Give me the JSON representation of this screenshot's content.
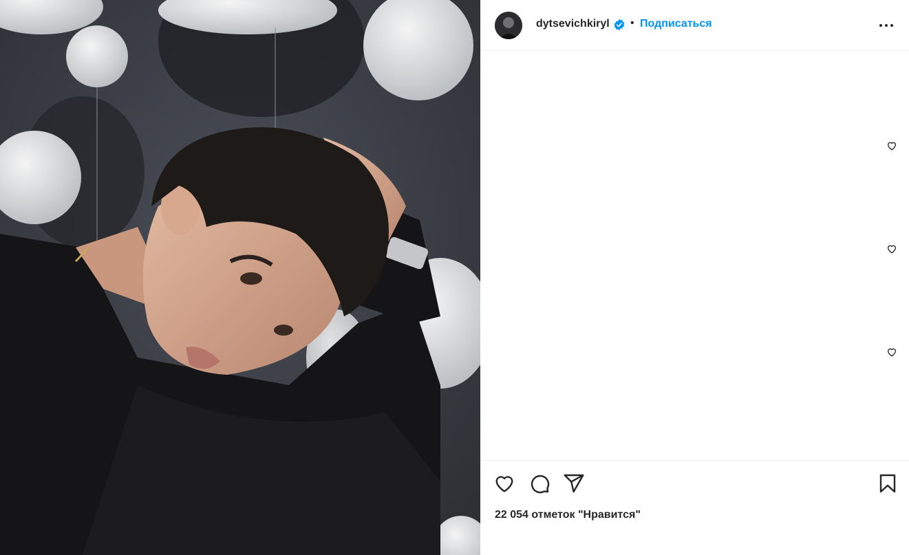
{
  "post": {
    "username": "dytsevichkiryl",
    "separator": "•",
    "follow_label": "Подписаться",
    "likes_text": "22 054 отметок \"Нравится\""
  },
  "icons": {
    "verified": "verified-badge-icon",
    "more": "more-options-icon",
    "like": "heart-icon",
    "comment": "comment-icon",
    "share": "share-icon",
    "save": "bookmark-icon"
  },
  "colors": {
    "accent": "#0095f6",
    "verified": "#0095f6",
    "text": "#262626"
  }
}
